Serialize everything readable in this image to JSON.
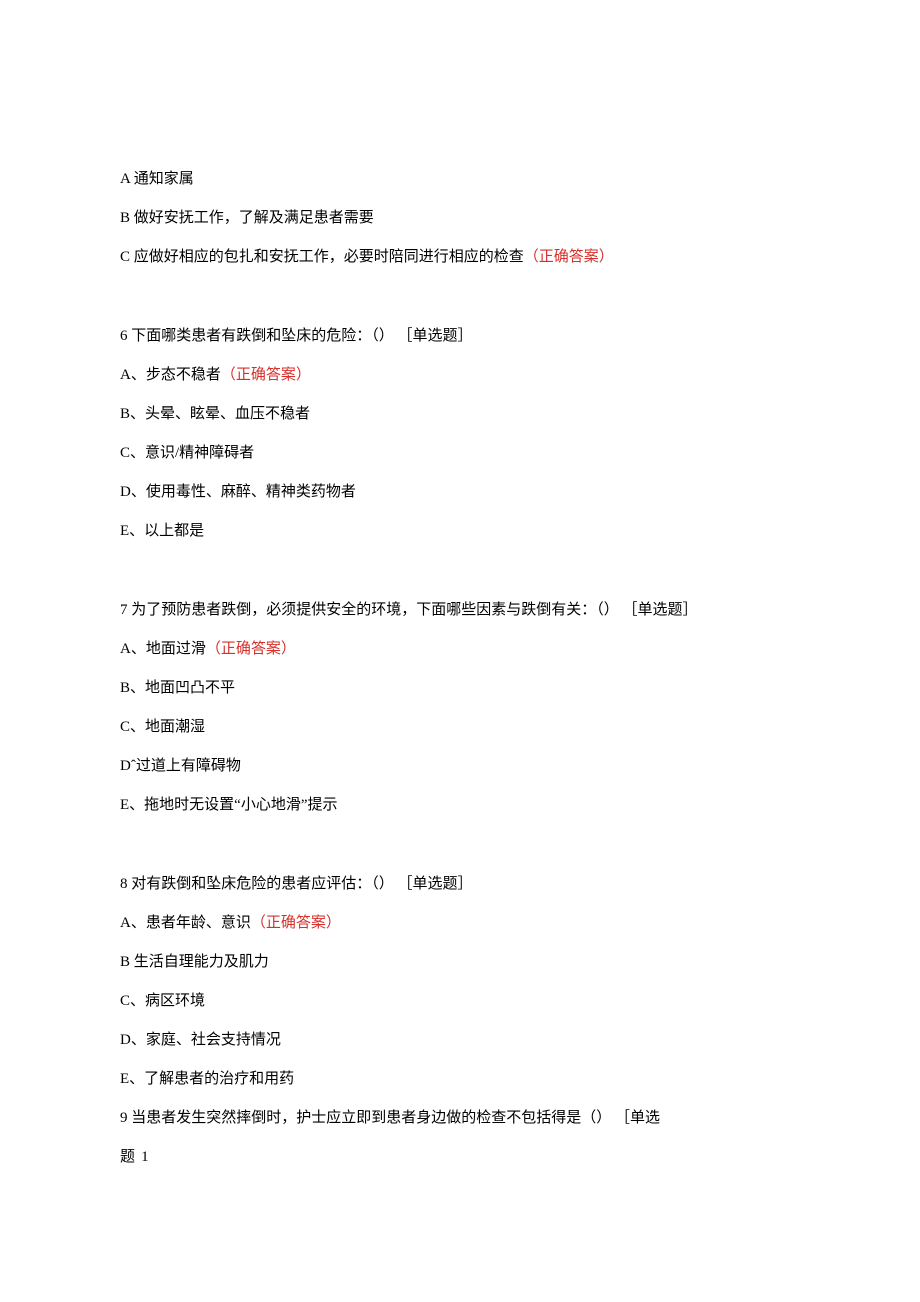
{
  "q5": {
    "optA": "A 通知家属",
    "optB": "B 做好安抚工作，了解及满足患者需要",
    "optC_pre": "C 应做好相应的包扎和安抚工作，必要时陪同进行相应的检查",
    "optC_ans": "（正确答案）"
  },
  "q6": {
    "stem": "6 下面哪类患者有跌倒和坠床的危险：（） ［单选题］",
    "optA_pre": "A、步态不稳者",
    "optA_ans": "（正确答案）",
    "optB": "B、头晕、眩晕、血压不稳者",
    "optC": "C、意识/精神障碍者",
    "optD": "D、使用毒性、麻醉、精神类药物者",
    "optE": "E、以上都是"
  },
  "q7": {
    "stem": "7 为了预防患者跌倒，必须提供安全的环境，下面哪些因素与跌倒有关：（） ［单选题］",
    "optA_pre": "A、地面过滑",
    "optA_ans": "（正确答案）",
    "optB": "B、地面凹凸不平",
    "optC": "C、地面潮湿",
    "optD": "Dˆ过道上有障碍物",
    "optE": "E、拖地时无设置“小心地滑”提示"
  },
  "q8": {
    "stem": "8 对有跌倒和坠床危险的患者应评估：（） ［单选题］",
    "optA_pre": "A、患者年龄、意识",
    "optA_ans": "（正确答案）",
    "optB": "B 生活自理能力及肌力",
    "optC": "C、病区环境",
    "optD": "D、家庭、社会支持情况",
    "optE": "E、了解患者的治疗和用药"
  },
  "q9": {
    "stem": "9 当患者发生突然摔倒时，护士应立即到患者身边做的检查不包括得是（） ［单选",
    "stem_cont": "题 1"
  }
}
